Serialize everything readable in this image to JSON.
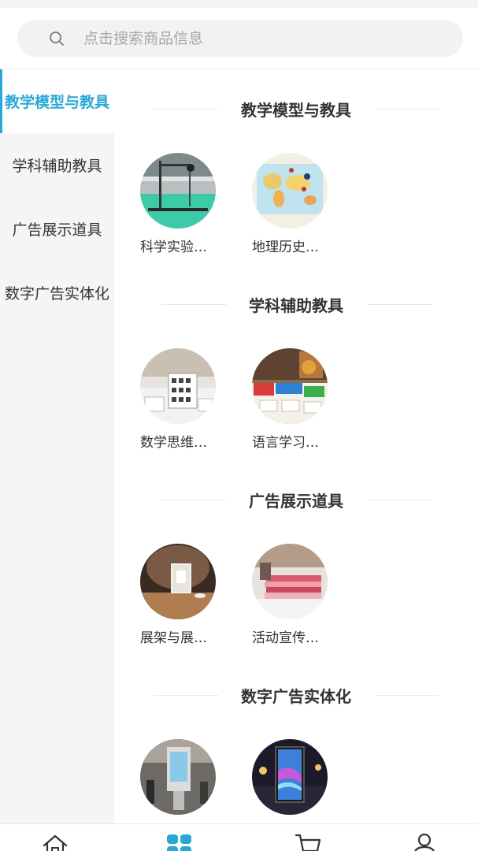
{
  "search": {
    "placeholder": "点击搜索商品信息"
  },
  "sidebar": {
    "items": [
      {
        "label": "教学模型与教具"
      },
      {
        "label": "学科辅助教具"
      },
      {
        "label": "广告展示道具"
      },
      {
        "label": "数字广告实体化"
      }
    ]
  },
  "sections": [
    {
      "title": "教学模型与教具",
      "items": [
        {
          "label": "科学实验…",
          "image": "science-experiment-apparatus"
        },
        {
          "label": "地理历史…",
          "image": "world-map-board"
        }
      ]
    },
    {
      "title": "学科辅助教具",
      "items": [
        {
          "label": "数学思维…",
          "image": "number-cards-board"
        },
        {
          "label": "语言学习…",
          "image": "language-flash-cards"
        }
      ]
    },
    {
      "title": "广告展示道具",
      "items": [
        {
          "label": "展架与展…",
          "image": "table-display-stand"
        },
        {
          "label": "活动宣传…",
          "image": "brochure-stack"
        }
      ]
    },
    {
      "title": "数字广告实体化",
      "items": [
        {
          "label": "",
          "image": "digital-signage-kiosk"
        },
        {
          "label": "",
          "image": "led-light-box"
        }
      ]
    }
  ],
  "tabbar": {
    "items": [
      {
        "icon": "home-icon"
      },
      {
        "icon": "category-icon",
        "active": true
      },
      {
        "icon": "cart-icon"
      },
      {
        "icon": "user-icon"
      }
    ]
  },
  "colors": {
    "accent": "#29a8d6",
    "sidebar_bg": "#f5f5f5",
    "text": "#333333"
  }
}
